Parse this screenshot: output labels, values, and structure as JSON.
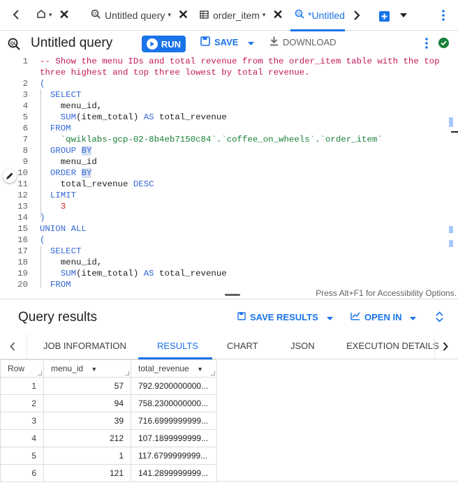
{
  "tabs": {
    "home_caret": "▾",
    "items": [
      {
        "label": "Untitled query",
        "caret": "▾"
      },
      {
        "label": "order_item",
        "caret": "▾"
      },
      {
        "label": "*Untitled",
        "caret": ""
      }
    ]
  },
  "toolbar": {
    "title": "Untitled query",
    "run_label": "RUN",
    "save_label": "SAVE",
    "download_label": "DOWNLOAD"
  },
  "editor": {
    "lines": [
      {
        "n": "1",
        "segments": [
          {
            "t": "-- Show the menu IDs and total revenue from the order_item table with the top",
            "c": "cm"
          }
        ]
      },
      {
        "n": "",
        "segments": [
          {
            "t": "three highest and top three lowest by total revenue.",
            "c": "cm"
          }
        ]
      },
      {
        "n": "2",
        "segments": [
          {
            "t": "(",
            "c": "kw"
          }
        ]
      },
      {
        "n": "3",
        "segments": [
          {
            "t": "  SELECT",
            "c": "kw"
          }
        ]
      },
      {
        "n": "4",
        "segments": [
          {
            "t": "    menu_id,",
            "c": ""
          }
        ]
      },
      {
        "n": "5",
        "segments": [
          {
            "t": "    SUM",
            "c": "kw"
          },
          {
            "t": "(item_total) ",
            "c": ""
          },
          {
            "t": "AS",
            "c": "kw"
          },
          {
            "t": " total_revenue",
            "c": ""
          }
        ]
      },
      {
        "n": "6",
        "segments": [
          {
            "t": "  FROM",
            "c": "kw"
          }
        ]
      },
      {
        "n": "7",
        "segments": [
          {
            "t": "    `qwiklabs-gcp-02-8b4eb7150c84`.`coffee_on_wheels`.`order_item`",
            "c": "st"
          }
        ]
      },
      {
        "n": "8",
        "segments": [
          {
            "t": "  GROUP ",
            "c": "kw"
          },
          {
            "t": "BY",
            "c": "kw hl"
          }
        ]
      },
      {
        "n": "9",
        "segments": [
          {
            "t": "    menu_id",
            "c": ""
          }
        ]
      },
      {
        "n": "10",
        "segments": [
          {
            "t": "  ORDER ",
            "c": "kw"
          },
          {
            "t": "BY",
            "c": "kw hl"
          }
        ]
      },
      {
        "n": "11",
        "segments": [
          {
            "t": "    total_revenue ",
            "c": ""
          },
          {
            "t": "DESC",
            "c": "kw"
          }
        ]
      },
      {
        "n": "12",
        "segments": [
          {
            "t": "  LIMIT",
            "c": "kw"
          }
        ]
      },
      {
        "n": "13",
        "segments": [
          {
            "t": "    3",
            "c": "nm"
          }
        ]
      },
      {
        "n": "14",
        "segments": [
          {
            "t": ")",
            "c": "kw"
          }
        ]
      },
      {
        "n": "15",
        "segments": [
          {
            "t": "UNION ALL",
            "c": "kw"
          }
        ]
      },
      {
        "n": "16",
        "segments": [
          {
            "t": "(",
            "c": "kw"
          }
        ]
      },
      {
        "n": "17",
        "segments": [
          {
            "t": "  SELECT",
            "c": "kw"
          }
        ]
      },
      {
        "n": "18",
        "segments": [
          {
            "t": "    menu_id,",
            "c": ""
          }
        ]
      },
      {
        "n": "19",
        "segments": [
          {
            "t": "    SUM",
            "c": "kw"
          },
          {
            "t": "(item_total) ",
            "c": ""
          },
          {
            "t": "AS",
            "c": "kw"
          },
          {
            "t": " total_revenue",
            "c": ""
          }
        ]
      },
      {
        "n": "20",
        "segments": [
          {
            "t": "  FROM",
            "c": "kw"
          }
        ]
      }
    ]
  },
  "a11y_hint": "Press Alt+F1 for Accessibility Options.",
  "results": {
    "title": "Query results",
    "save_results_label": "SAVE RESULTS",
    "open_in_label": "OPEN IN",
    "tabs": [
      "JOB INFORMATION",
      "RESULTS",
      "CHART",
      "JSON",
      "EXECUTION DETAILS"
    ],
    "columns": [
      "Row",
      "menu_id",
      "total_revenue"
    ],
    "rows": [
      [
        "1",
        "57",
        "792.9200000000..."
      ],
      [
        "2",
        "94",
        "758.2300000000..."
      ],
      [
        "3",
        "39",
        "716.6999999999..."
      ],
      [
        "4",
        "212",
        "107.1899999999..."
      ],
      [
        "5",
        "1",
        "117.6799999999..."
      ],
      [
        "6",
        "121",
        "141.2899999999..."
      ]
    ]
  },
  "colors": {
    "accent": "#1a73e8",
    "keyword": "#3367d6",
    "comment": "#c2185b",
    "string": "#188038",
    "status_ok": "#188038"
  }
}
